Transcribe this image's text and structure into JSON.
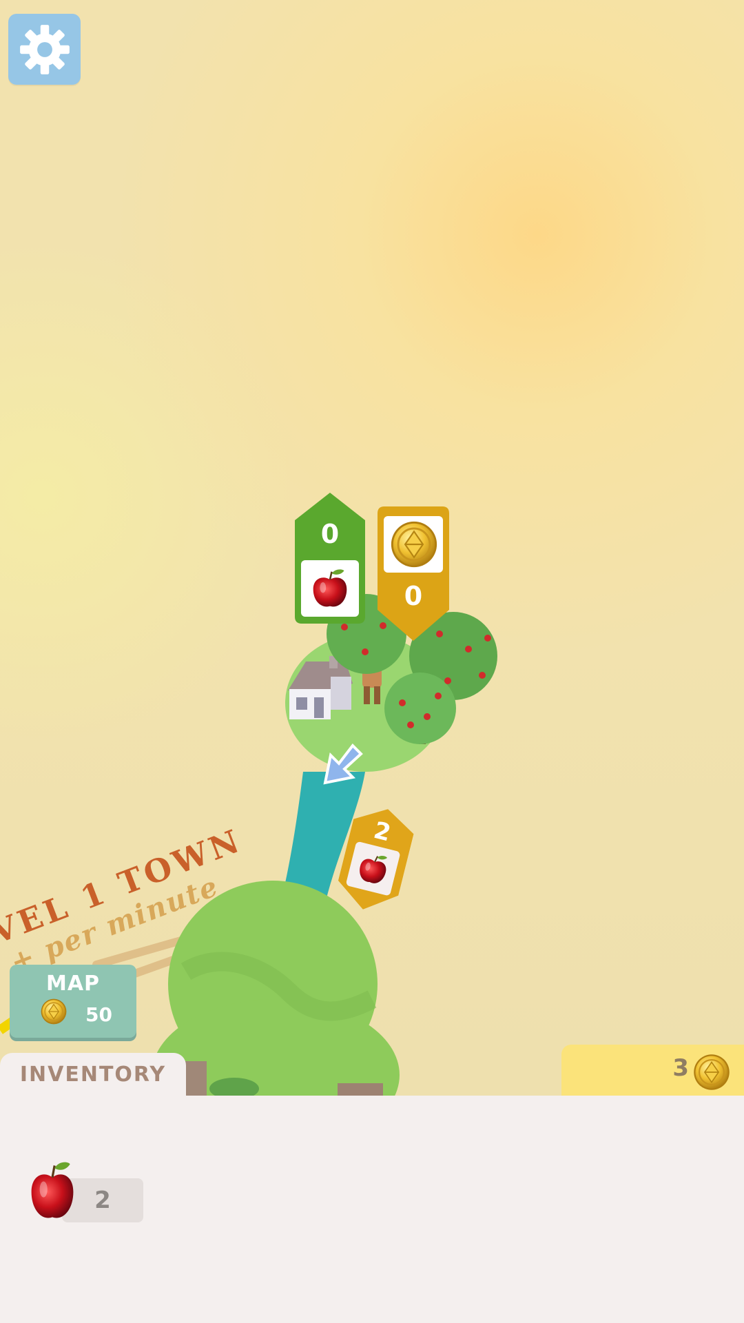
{
  "settings": {
    "icon": "gear-icon"
  },
  "town": {
    "title": "VEL 1 TOWN",
    "rate": "+ per minute"
  },
  "tags": {
    "apple_stock": {
      "count": "0",
      "icon": "apple-icon",
      "color": "#5aa82e"
    },
    "coin_stock": {
      "count": "0",
      "icon": "coin-icon",
      "color": "#dca416"
    },
    "apple_carried": {
      "count": "2",
      "icon": "apple-icon",
      "color": "#e0a51a"
    }
  },
  "map_button": {
    "label": "MAP",
    "cost": "50",
    "icon": "coin-icon"
  },
  "inventory": {
    "tab_label": "INVENTORY",
    "items": [
      {
        "icon": "apple-icon",
        "count": "2"
      }
    ]
  },
  "currency": {
    "coins": "3",
    "icon": "coin-icon"
  },
  "colors": {
    "background": "#f2e2ae",
    "panel": "#f4efee",
    "accent_green": "#5aa82e",
    "accent_gold": "#dca416"
  }
}
